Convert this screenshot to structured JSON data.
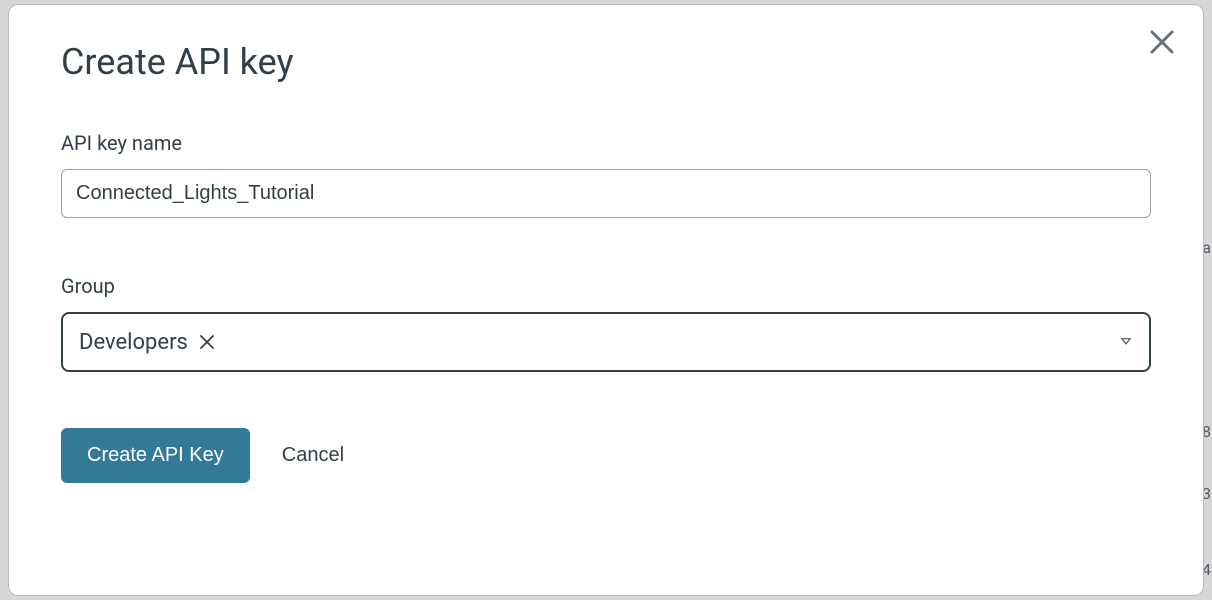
{
  "modal": {
    "title": "Create API key",
    "fields": {
      "name_label": "API key name",
      "name_value": "Connected_Lights_Tutorial",
      "group_label": "Group",
      "group_chip": "Developers"
    },
    "actions": {
      "primary": "Create API Key",
      "cancel": "Cancel"
    }
  },
  "colors": {
    "primary_button": "#337a99",
    "text": "#333f48"
  }
}
